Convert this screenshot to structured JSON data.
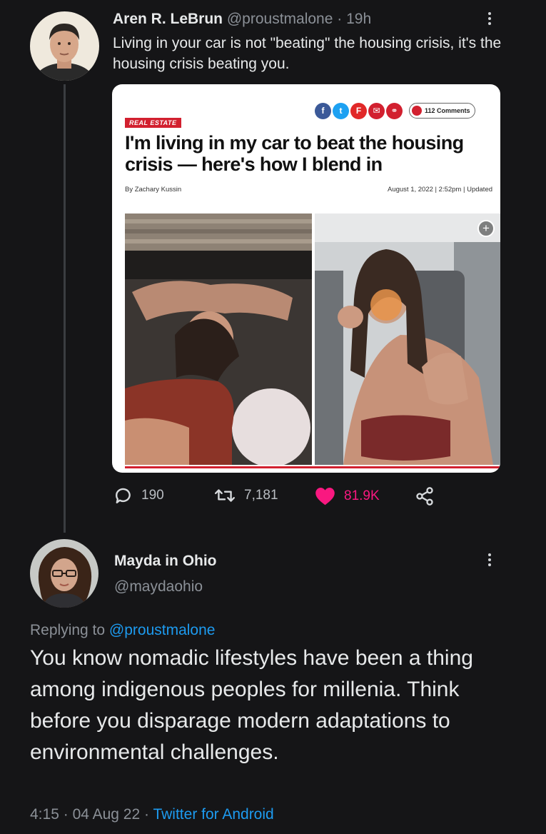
{
  "tweet": {
    "author_name": "Aren R. LeBrun",
    "handle": "@proustmalone",
    "separator": "·",
    "time": "19h",
    "text": "Living in your car is not \"beating\" the housing crisis, it's the housing crisis beating you.",
    "card": {
      "category": "REAL ESTATE",
      "headline": "I'm living in my car to beat the housing crisis — here's how I blend in",
      "byline": "By Zachary Kussin",
      "date": "August 1, 2022 | 2:52pm | Updated",
      "comments_label": "112 Comments",
      "share_icons": [
        {
          "name": "facebook-icon",
          "glyph": "f",
          "color": "#3b5998"
        },
        {
          "name": "twitter-icon",
          "glyph": "t",
          "color": "#1da1f2"
        },
        {
          "name": "flipboard-icon",
          "glyph": "F",
          "color": "#e12828"
        },
        {
          "name": "email-icon",
          "glyph": "✉",
          "color": "#d2202f"
        },
        {
          "name": "link-icon",
          "glyph": "⚭",
          "color": "#d2202f"
        }
      ],
      "plus_glyph": "+"
    },
    "stats": {
      "replies": "190",
      "retweets": "7,181",
      "likes": "81.9K"
    }
  },
  "reply": {
    "author_name": "Mayda in Ohio",
    "handle": "@maydaohio",
    "replying_prefix": "Replying to",
    "replying_to": "@proustmalone",
    "text": "You know nomadic lifestyles have been a thing among indigenous peoples for millenia. Think before you disparage modern adaptations to environmental challenges.",
    "time": "4:15",
    "date": "04 Aug 22",
    "source": "Twitter for Android",
    "separator": "·"
  },
  "colors": {
    "background": "#151517",
    "muted": "#8b9097",
    "link": "#1d9bf0",
    "like": "#f91880",
    "brand_red": "#d2202f"
  }
}
